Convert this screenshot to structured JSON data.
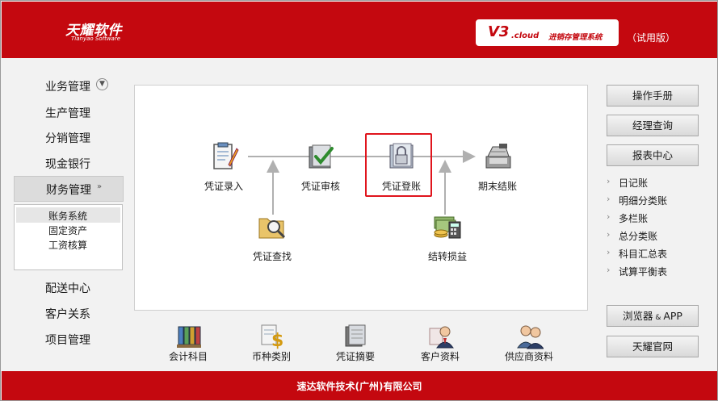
{
  "header": {
    "logo_cn": "天耀软件",
    "logo_en": "Tianyao Software",
    "version": "V3",
    "version_cloud": ".cloud",
    "system_name": "进销存管理系统",
    "trial": "（试用版）"
  },
  "sidebar": {
    "items_top": [
      {
        "label": "业务管理",
        "icon": "chevron-down-circle"
      },
      {
        "label": "生产管理"
      },
      {
        "label": "分销管理"
      },
      {
        "label": "现金银行"
      },
      {
        "label": "财务管理",
        "icon": "chevron-down",
        "active": true
      }
    ],
    "sub_items": [
      {
        "label": "账务系统",
        "selected": true
      },
      {
        "label": "固定资产"
      },
      {
        "label": "工资核算"
      }
    ],
    "items_bottom": [
      {
        "label": "配送中心"
      },
      {
        "label": "客户关系"
      },
      {
        "label": "项目管理"
      }
    ]
  },
  "flow": {
    "nodes": [
      {
        "label": "凭证录入",
        "icon": "clipboard-pen-icon"
      },
      {
        "label": "凭证审核",
        "icon": "folder-check-icon"
      },
      {
        "label": "凭证登账",
        "icon": "folder-lock-icon",
        "highlighted": true
      },
      {
        "label": "期末结账",
        "icon": "cash-register-icon"
      },
      {
        "label": "凭证查找",
        "icon": "folder-search-icon"
      },
      {
        "label": "结转损益",
        "icon": "money-calculator-icon"
      }
    ]
  },
  "bottom_toolbar": [
    {
      "label": "会计科目",
      "icon": "binders-icon"
    },
    {
      "label": "币种类别",
      "icon": "currency-icon"
    },
    {
      "label": "凭证摘要",
      "icon": "document-stack-icon"
    },
    {
      "label": "客户资料",
      "icon": "customer-icon"
    },
    {
      "label": "供应商资料",
      "icon": "supplier-icon"
    }
  ],
  "right_panel": {
    "manual": "操作手册",
    "manager_query": "经理查询",
    "report_center": "报表中心",
    "reports": [
      "日记账",
      "明细分类账",
      "多栏账",
      "总分类账",
      "科目汇总表",
      "试算平衡表"
    ],
    "browser_app": "浏览器",
    "browser_app_amp": " & ",
    "browser_app_app": "APP",
    "official_site": "天耀官网"
  },
  "footer": {
    "company": "速达软件技术(广州)有限公司"
  },
  "colors": {
    "brand_red": "#c4080f",
    "highlight": "#e0141c",
    "flow_line": "#b0b0b0"
  }
}
